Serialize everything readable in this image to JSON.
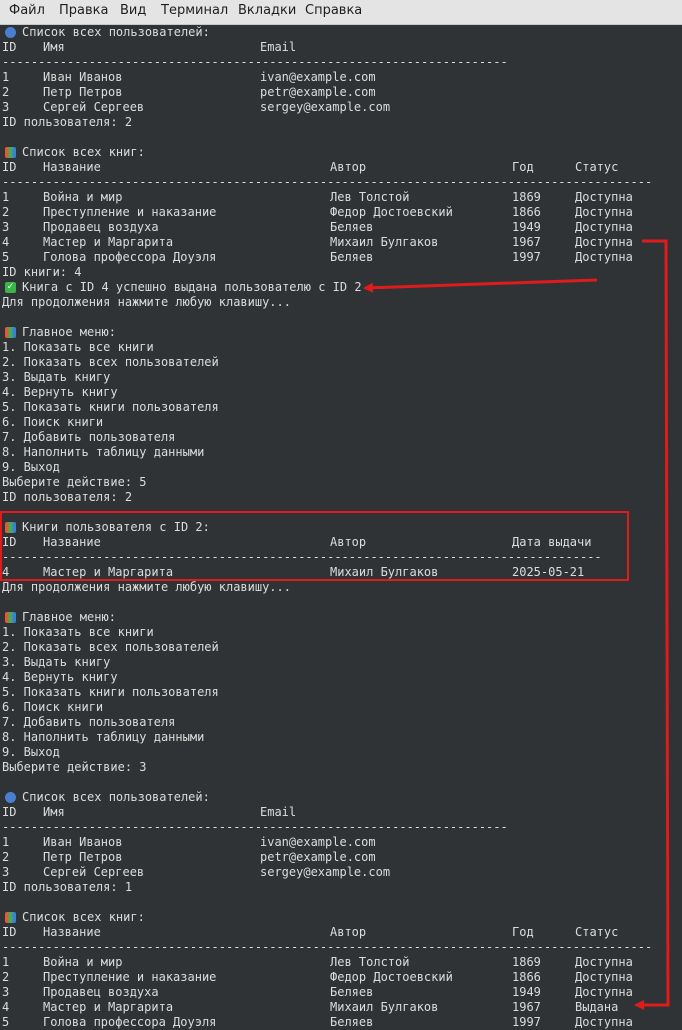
{
  "menubar": {
    "items": [
      "Файл",
      "Правка",
      "Вид",
      "Терминал",
      "Вкладки",
      "Справка"
    ]
  },
  "users_block": {
    "title": "Список всех пользователей:",
    "col_id": "ID",
    "col_name": "Имя",
    "col_email": "Email",
    "separator": "----------------------------------------------------------------------",
    "rows": [
      {
        "id": "1",
        "name": "Иван Иванов",
        "email": "ivan@example.com"
      },
      {
        "id": "2",
        "name": "Петр Петров",
        "email": "petr@example.com"
      },
      {
        "id": "3",
        "name": "Сергей Сергеев",
        "email": "sergey@example.com"
      }
    ]
  },
  "books_block": {
    "title": "Список всех книг:",
    "col_id": "ID",
    "col_title": "Название",
    "col_author": "Автор",
    "col_year": "Год",
    "col_status": "Статус",
    "separator": "------------------------------------------------------------------------------------------",
    "rows": [
      {
        "id": "1",
        "title": "Война и мир",
        "author": "Лев Толстой",
        "year": "1869",
        "status": "Доступна"
      },
      {
        "id": "2",
        "title": "Преступление и наказание",
        "author": "Федор Достоевский",
        "year": "1866",
        "status": "Доступна"
      },
      {
        "id": "3",
        "title": "Продавец воздуха",
        "author": "Беляев",
        "year": "1949",
        "status": "Доступна"
      },
      {
        "id": "4",
        "title": "Мастер и Маргарита",
        "author": "Михаил Булгаков",
        "year": "1967",
        "status": "Доступна"
      },
      {
        "id": "5",
        "title": "Голова профессора Доуэля",
        "author": "Беляев",
        "year": "1997",
        "status": "Доступна"
      }
    ],
    "rows_after": [
      {
        "id": "1",
        "title": "Война и мир",
        "author": "Лев Толстой",
        "year": "1869",
        "status": "Доступна"
      },
      {
        "id": "2",
        "title": "Преступление и наказание",
        "author": "Федор Достоевский",
        "year": "1866",
        "status": "Доступна"
      },
      {
        "id": "3",
        "title": "Продавец воздуха",
        "author": "Беляев",
        "year": "1949",
        "status": "Доступна"
      },
      {
        "id": "4",
        "title": "Мастер и Маргарита",
        "author": "Михаил Булгаков",
        "year": "1967",
        "status": "Выдана"
      },
      {
        "id": "5",
        "title": "Голова профессора Доуэля",
        "author": "Беляев",
        "year": "1997",
        "status": "Доступна"
      }
    ]
  },
  "prompts": {
    "user_id_2": "ID пользователя: 2",
    "user_id_1": "ID пользователя: 1",
    "book_id_4": "ID книги: 4",
    "issued_msg": "Книга с ID 4 успешно выдана пользователю с ID 2",
    "press_any_key": "Для продолжения нажмите любую клавишу...",
    "choose_5": "Выберите действие: 5",
    "choose_3": "Выберите действие: 3"
  },
  "main_menu": {
    "title": "Главное меню:",
    "items": [
      "1. Показать все книги",
      "2. Показать всех пользователей",
      "3. Выдать книгу",
      "4. Вернуть книгу",
      "5. Показать книги пользователя",
      "6. Поиск книги",
      "7. Добавить пользователя",
      "8. Наполнить таблицу данными",
      "9. Выход"
    ]
  },
  "user_books_block": {
    "title": "Книги пользователя с ID 2:",
    "col_id": "ID",
    "col_title": "Название",
    "col_author": "Автор",
    "col_date": "Дата выдачи",
    "separator": "-----------------------------------------------------------------------------------",
    "rows": [
      {
        "id": "4",
        "title": "Мастер и Маргарита",
        "author": "Михаил Булгаков",
        "date": "2025-05-21"
      }
    ]
  },
  "icons": {
    "users": "busts-emoji-icon",
    "books": "books-emoji-icon",
    "menu": "books-emoji-icon",
    "check": "check-mark-emoji-icon"
  },
  "colors": {
    "terminal_bg": "#2f3335",
    "terminal_fg": "#dcdcdc",
    "annotation_red": "#e01b1b"
  }
}
